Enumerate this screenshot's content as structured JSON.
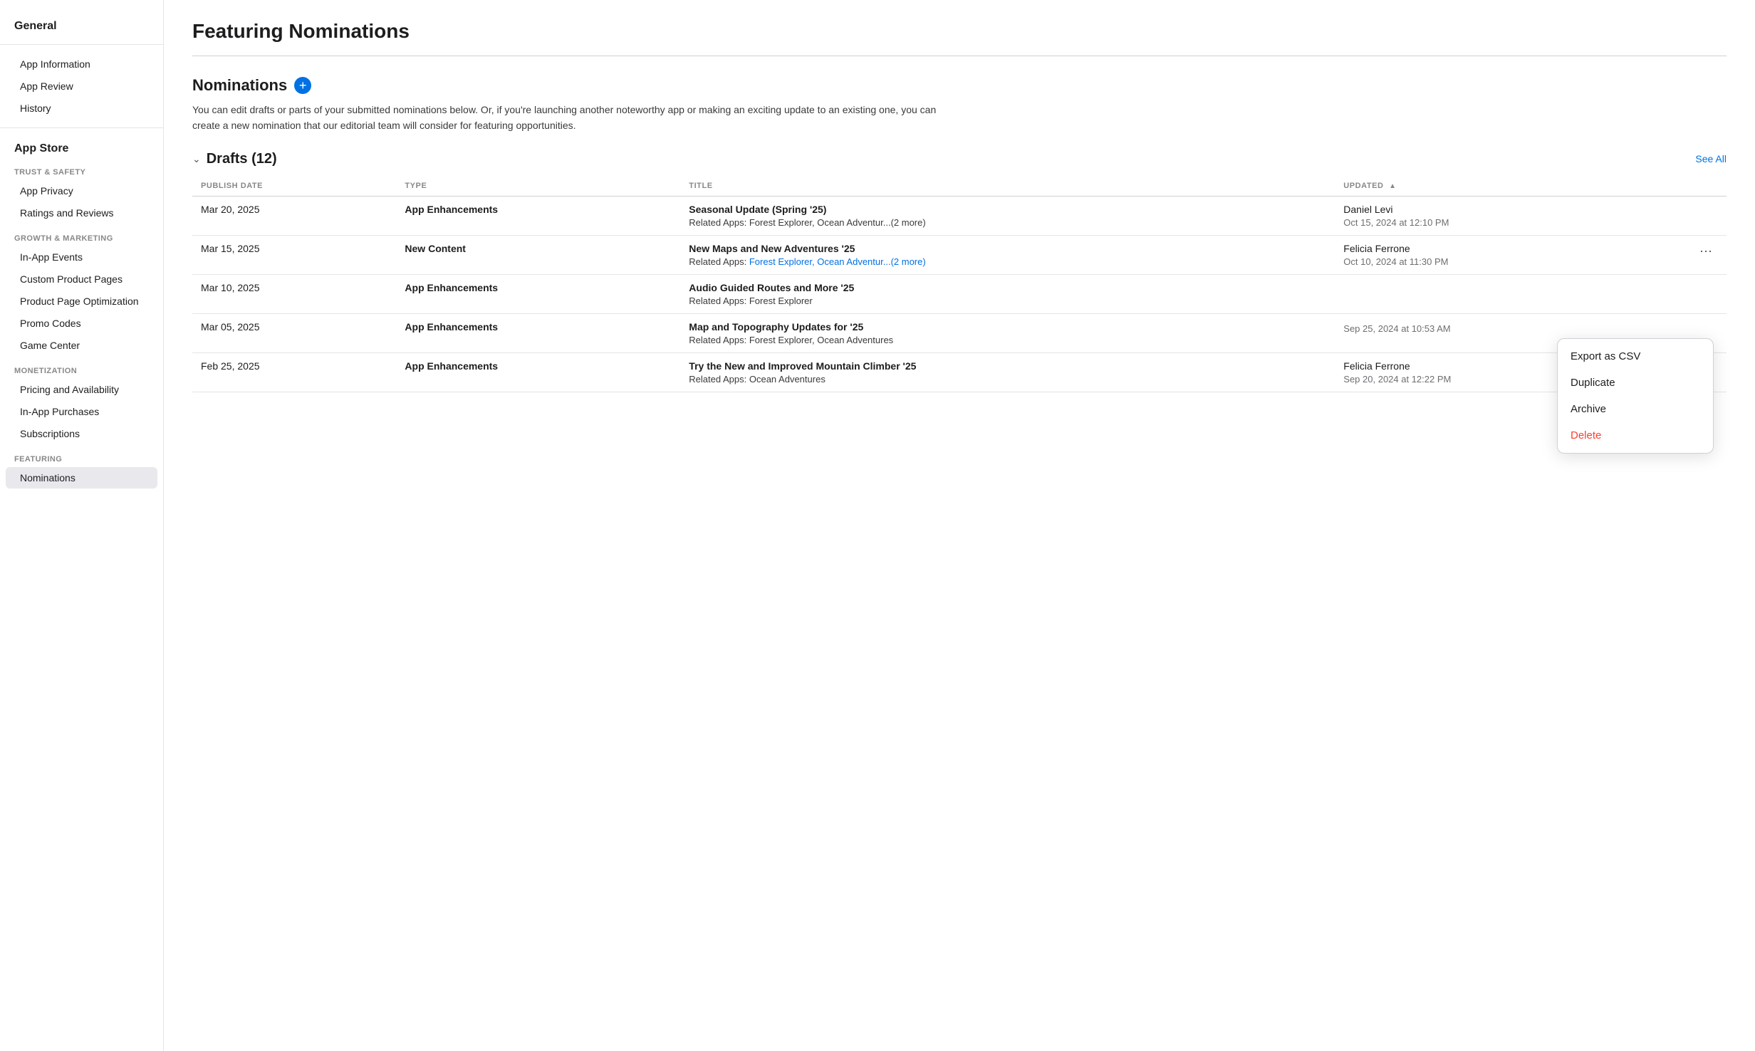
{
  "sidebar": {
    "general_title": "General",
    "general_items": [
      {
        "label": "App Information",
        "id": "app-information",
        "active": false
      },
      {
        "label": "App Review",
        "id": "app-review",
        "active": false
      },
      {
        "label": "History",
        "id": "history",
        "active": false
      }
    ],
    "appstore_title": "App Store",
    "trust_safety_label": "TRUST & SAFETY",
    "trust_items": [
      {
        "label": "App Privacy",
        "id": "app-privacy",
        "active": false
      },
      {
        "label": "Ratings and Reviews",
        "id": "ratings-reviews",
        "active": false
      }
    ],
    "growth_label": "GROWTH & MARKETING",
    "growth_items": [
      {
        "label": "In-App Events",
        "id": "in-app-events",
        "active": false
      },
      {
        "label": "Custom Product Pages",
        "id": "custom-product-pages",
        "active": false
      },
      {
        "label": "Product Page Optimization",
        "id": "product-page-optimization",
        "active": false
      },
      {
        "label": "Promo Codes",
        "id": "promo-codes",
        "active": false
      },
      {
        "label": "Game Center",
        "id": "game-center",
        "active": false
      }
    ],
    "monetization_label": "MONETIZATION",
    "monetization_items": [
      {
        "label": "Pricing and Availability",
        "id": "pricing",
        "active": false
      },
      {
        "label": "In-App Purchases",
        "id": "in-app-purchases",
        "active": false
      },
      {
        "label": "Subscriptions",
        "id": "subscriptions",
        "active": false
      }
    ],
    "featuring_label": "FEATURING",
    "featuring_items": [
      {
        "label": "Nominations",
        "id": "nominations",
        "active": true
      }
    ]
  },
  "page": {
    "title": "Featuring Nominations",
    "section_title": "Nominations",
    "add_btn_label": "+",
    "description": "You can edit drafts or parts of your submitted nominations below. Or, if you're launching another noteworthy app or making an exciting update to an existing one, you can create a new nomination that our editorial team will consider for featuring opportunities.",
    "drafts_label": "Drafts (12)",
    "see_all_label": "See All",
    "table": {
      "columns": [
        {
          "id": "publish_date",
          "label": "PUBLISH DATE",
          "sortable": false
        },
        {
          "id": "type",
          "label": "TYPE",
          "sortable": false
        },
        {
          "id": "title",
          "label": "TITLE",
          "sortable": false
        },
        {
          "id": "updated",
          "label": "UPDATED",
          "sortable": true
        }
      ],
      "rows": [
        {
          "publish_date": "Mar 20, 2025",
          "type": "App Enhancements",
          "title": "Seasonal Update (Spring '25)",
          "related_label": "Related Apps:",
          "related_apps": "Forest Explorer, Ocean Adventur...(2 more)",
          "related_link": false,
          "updated_by": "Daniel Levi",
          "updated_at": "Oct 15, 2024 at 12:10 PM",
          "has_menu": false
        },
        {
          "publish_date": "Mar 15, 2025",
          "type": "New Content",
          "title": "New Maps and New Adventures '25",
          "related_label": "Related Apps:",
          "related_apps": "Forest Explorer, Ocean Adventur...(2 more)",
          "related_link": true,
          "updated_by": "Felicia Ferrone",
          "updated_at": "Oct 10, 2024 at 11:30 PM",
          "has_menu": true
        },
        {
          "publish_date": "Mar 10, 2025",
          "type": "App Enhancements",
          "title": "Audio Guided Routes and More '25",
          "related_label": "Related Apps:",
          "related_apps": "Forest Explorer",
          "related_link": false,
          "updated_by": "",
          "updated_at": "",
          "has_menu": false
        },
        {
          "publish_date": "Mar 05, 2025",
          "type": "App Enhancements",
          "title": "Map and Topography Updates for '25",
          "related_label": "Related Apps:",
          "related_apps": "Forest Explorer, Ocean Adventures",
          "related_link": false,
          "updated_by": "",
          "updated_at": "Sep 25, 2024 at 10:53 AM",
          "has_menu": false
        },
        {
          "publish_date": "Feb 25, 2025",
          "type": "App Enhancements",
          "title": "Try the New and Improved Mountain Climber '25",
          "related_label": "Related Apps:",
          "related_apps": "Ocean Adventures",
          "related_link": false,
          "updated_by": "Felicia Ferrone",
          "updated_at": "Sep 20, 2024 at 12:22 PM",
          "has_menu": false
        }
      ]
    }
  },
  "dropdown": {
    "items": [
      {
        "label": "Export as CSV",
        "id": "export-csv",
        "danger": false
      },
      {
        "label": "Duplicate",
        "id": "duplicate",
        "danger": false
      },
      {
        "label": "Archive",
        "id": "archive",
        "danger": false
      },
      {
        "label": "Delete",
        "id": "delete",
        "danger": true
      }
    ]
  }
}
